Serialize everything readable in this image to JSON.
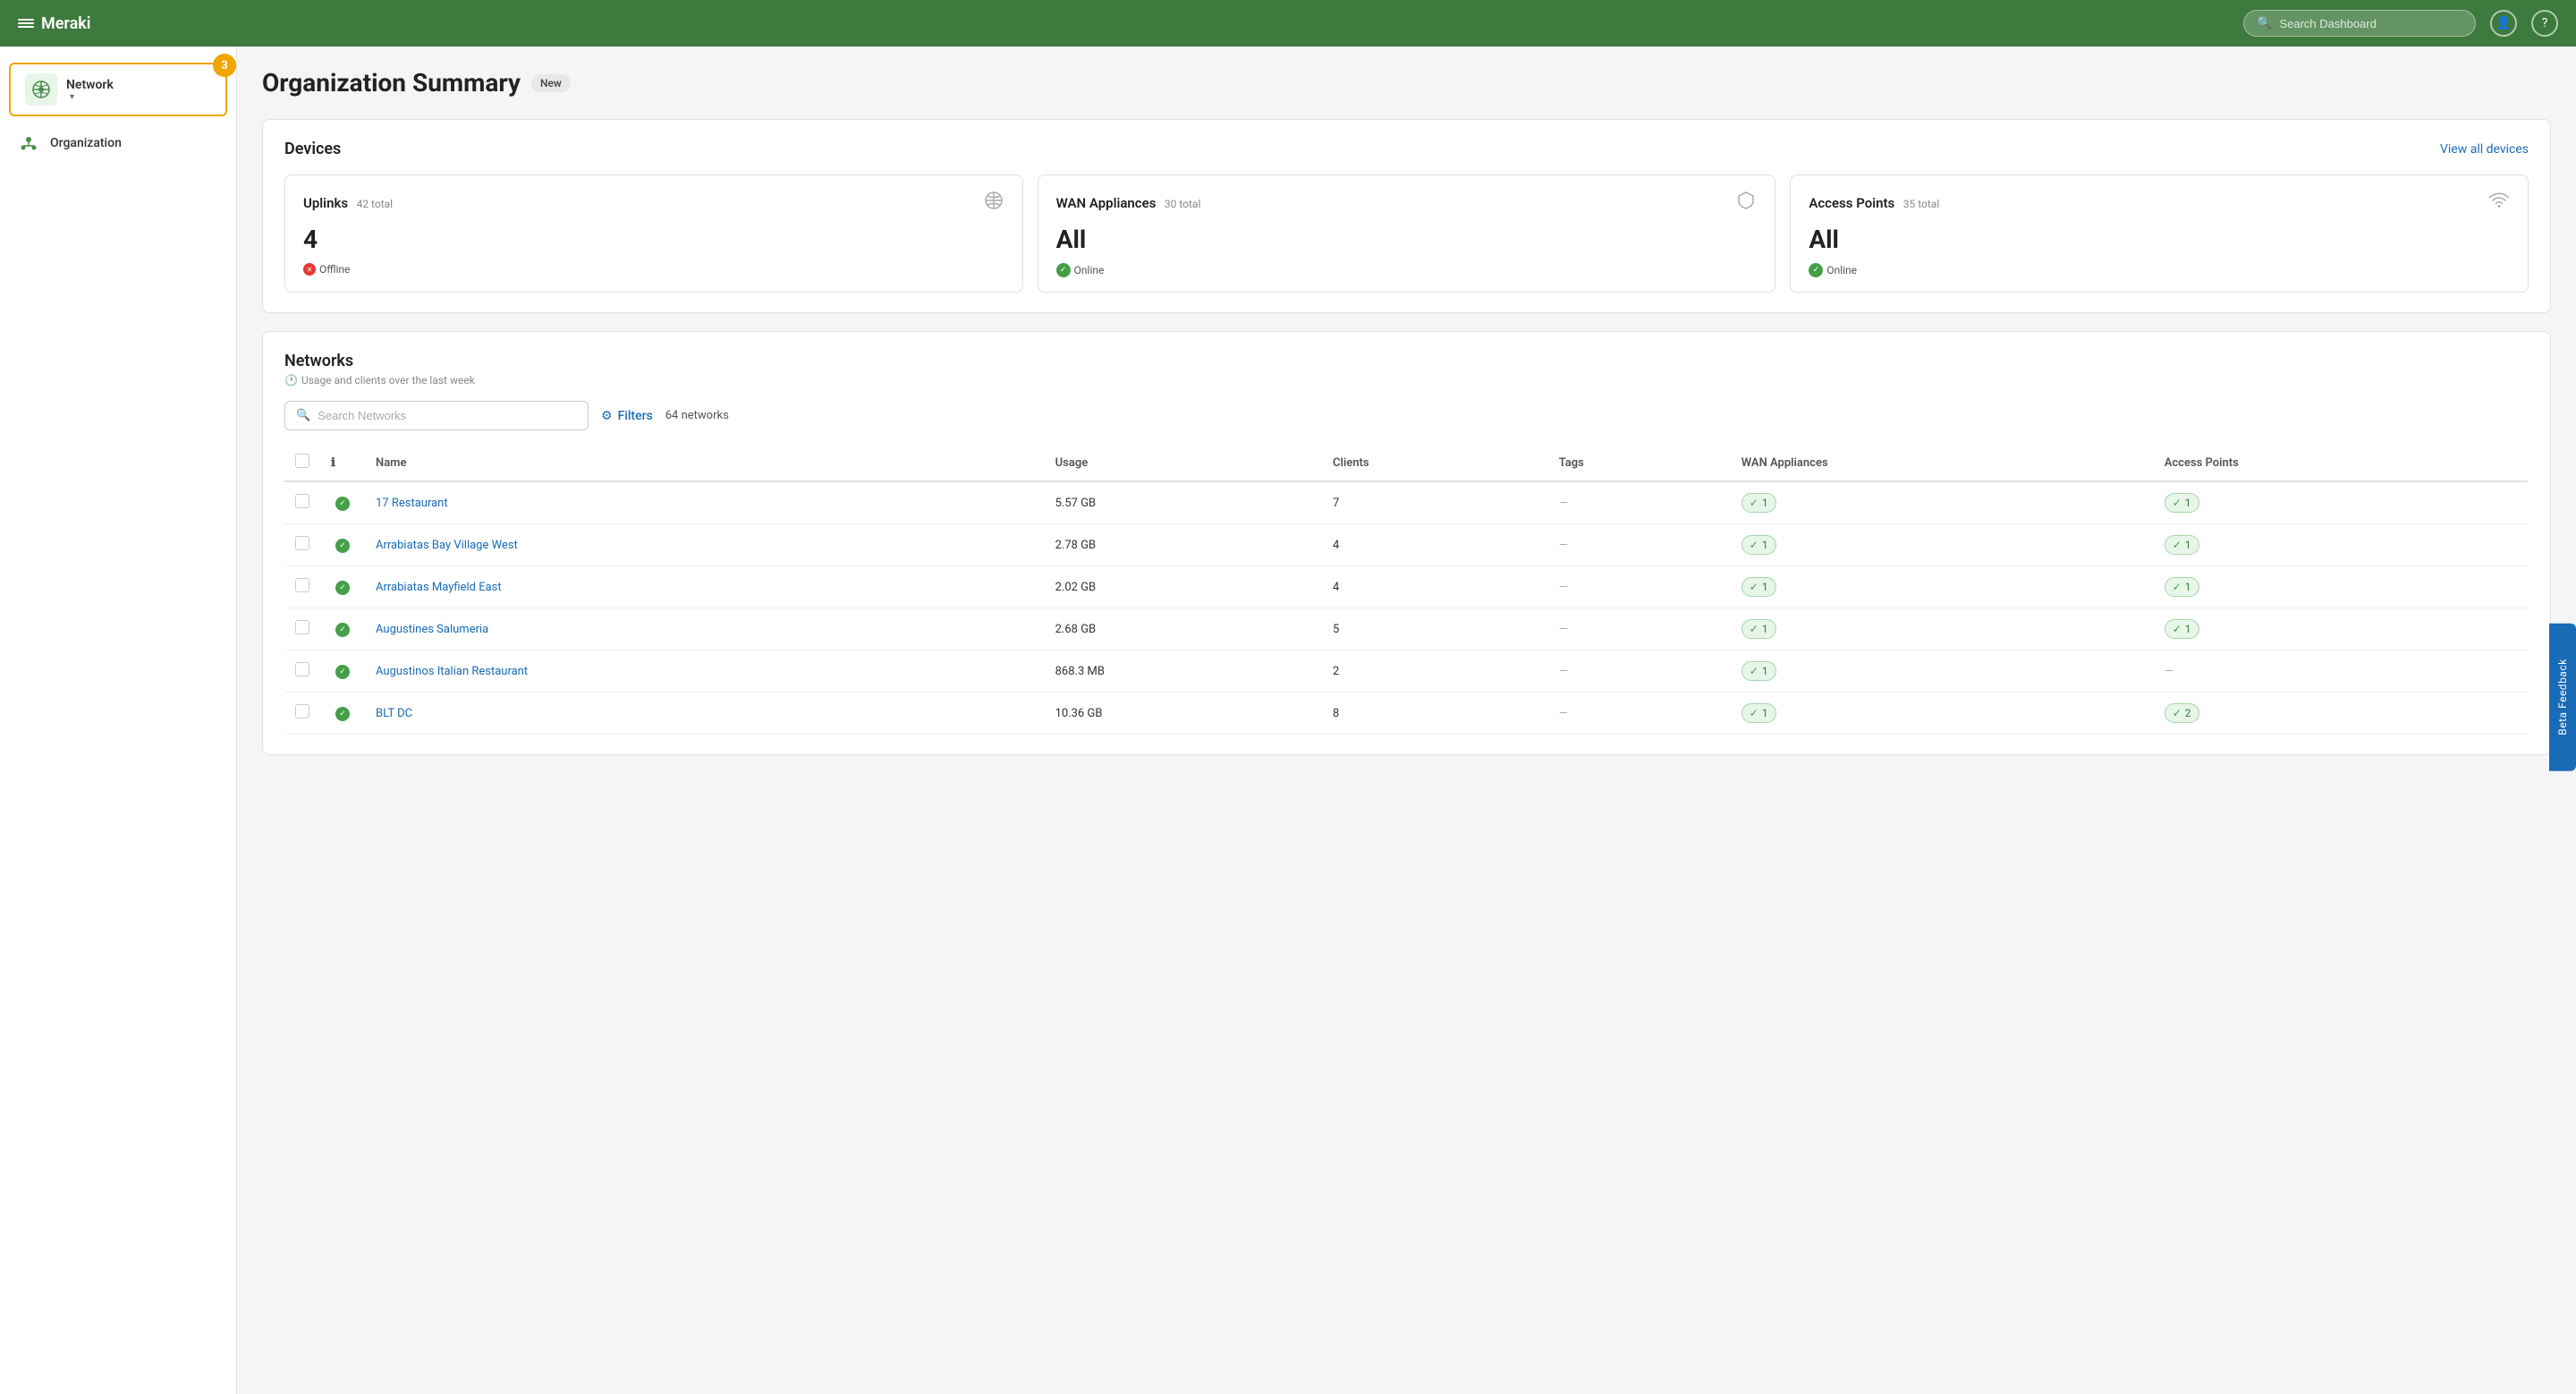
{
  "header": {
    "brand": "Meraki",
    "search_placeholder": "Search Dashboard"
  },
  "sidebar": {
    "network_label": "Network",
    "network_badge": "3",
    "org_label": "Organization"
  },
  "page": {
    "title": "Organization Summary",
    "badge": "New"
  },
  "devices_section": {
    "title": "Devices",
    "view_all": "View all devices",
    "cards": [
      {
        "type": "Uplinks",
        "total": "42 total",
        "value": "4",
        "status": "Offline",
        "status_type": "error"
      },
      {
        "type": "WAN Appliances",
        "total": "30 total",
        "value": "All",
        "status": "Online",
        "status_type": "ok"
      },
      {
        "type": "Access Points",
        "total": "35 total",
        "value": "All",
        "status": "Online",
        "status_type": "ok"
      }
    ]
  },
  "networks_section": {
    "title": "Networks",
    "subtitle": "Usage and clients over the last week",
    "search_placeholder": "Search Networks",
    "filters_label": "Filters",
    "network_count": "64 networks",
    "columns": [
      "Name",
      "Usage",
      "Clients",
      "Tags",
      "WAN Appliances",
      "Access Points"
    ],
    "rows": [
      {
        "name": "17 Restaurant",
        "usage": "5.57 GB",
        "clients": "7",
        "tags": "—",
        "wan": "1",
        "ap": "1"
      },
      {
        "name": "Arrabiatas Bay Village West",
        "usage": "2.78 GB",
        "clients": "4",
        "tags": "—",
        "wan": "1",
        "ap": "1"
      },
      {
        "name": "Arrabiatas Mayfield East",
        "usage": "2.02 GB",
        "clients": "4",
        "tags": "—",
        "wan": "1",
        "ap": "1"
      },
      {
        "name": "Augustines Salumeria",
        "usage": "2.68 GB",
        "clients": "5",
        "tags": "—",
        "wan": "1",
        "ap": "1"
      },
      {
        "name": "Augustinos Italian Restaurant",
        "usage": "868.3 MB",
        "clients": "2",
        "tags": "—",
        "wan": "1",
        "ap": "—"
      },
      {
        "name": "BLT DC",
        "usage": "10.36 GB",
        "clients": "8",
        "tags": "—",
        "wan": "1",
        "ap": "2"
      }
    ]
  },
  "beta_feedback": "Beta Feedback"
}
